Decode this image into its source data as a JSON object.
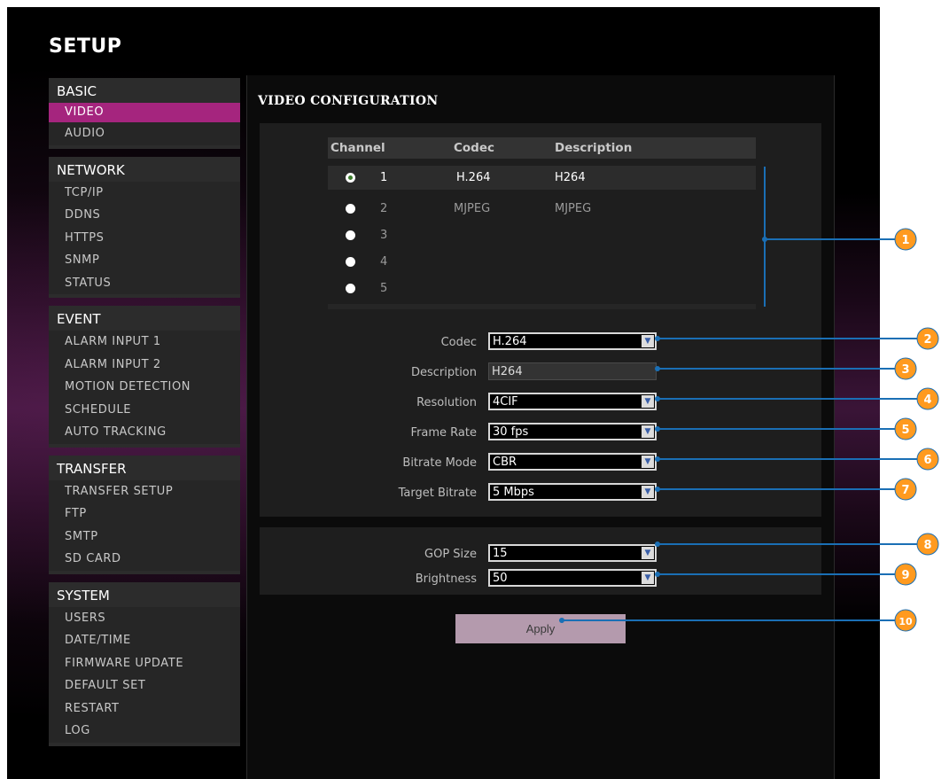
{
  "page_title": "SETUP",
  "section_title": "VIDEO CONFIGURATION",
  "sidebar": {
    "groups": [
      {
        "title": "BASIC",
        "items": [
          "VIDEO",
          "AUDIO"
        ]
      },
      {
        "title": "NETWORK",
        "items": [
          "TCP/IP",
          "DDNS",
          "HTTPS",
          "SNMP",
          "STATUS"
        ]
      },
      {
        "title": "EVENT",
        "items": [
          "ALARM INPUT 1",
          "ALARM INPUT 2",
          "MOTION DETECTION",
          "SCHEDULE",
          "AUTO TRACKING"
        ]
      },
      {
        "title": "TRANSFER",
        "items": [
          "TRANSFER SETUP",
          "FTP",
          "SMTP",
          "SD CARD"
        ]
      },
      {
        "title": "SYSTEM",
        "items": [
          "USERS",
          "DATE/TIME",
          "FIRMWARE UPDATE",
          "DEFAULT SET",
          "RESTART",
          "LOG"
        ]
      }
    ],
    "active_item": "VIDEO"
  },
  "channel_table": {
    "headers": {
      "channel": "Channel",
      "codec": "Codec",
      "description": "Description"
    },
    "rows": [
      {
        "channel": "1",
        "codec": "H.264",
        "description": "H264",
        "selected": true
      },
      {
        "channel": "2",
        "codec": "MJPEG",
        "description": "MJPEG",
        "selected": false
      },
      {
        "channel": "3",
        "codec": "",
        "description": "",
        "selected": false
      },
      {
        "channel": "4",
        "codec": "",
        "description": "",
        "selected": false
      },
      {
        "channel": "5",
        "codec": "",
        "description": "",
        "selected": false
      }
    ]
  },
  "form": {
    "codec": {
      "label": "Codec",
      "value": "H.264"
    },
    "description": {
      "label": "Description",
      "value": "H264"
    },
    "resolution": {
      "label": "Resolution",
      "value": "4CIF"
    },
    "frame_rate": {
      "label": "Frame Rate",
      "value": "30 fps"
    },
    "bitrate_mode": {
      "label": "Bitrate Mode",
      "value": "CBR"
    },
    "target_bitrate": {
      "label": "Target Bitrate",
      "value": "5 Mbps"
    },
    "gop_size": {
      "label": "GOP Size",
      "value": "15"
    },
    "brightness": {
      "label": "Brightness",
      "value": "50"
    }
  },
  "apply_label": "Apply",
  "callouts": [
    "1",
    "2",
    "3",
    "4",
    "5",
    "6",
    "7",
    "8",
    "9",
    "10"
  ],
  "colors": {
    "accent_active": "#a5257e",
    "callout_blue": "#1a6fb5",
    "callout_badge": "#ff9a1f"
  },
  "icons": {
    "select_arrow": "chevron-down-icon",
    "radio": "radio-icon"
  }
}
